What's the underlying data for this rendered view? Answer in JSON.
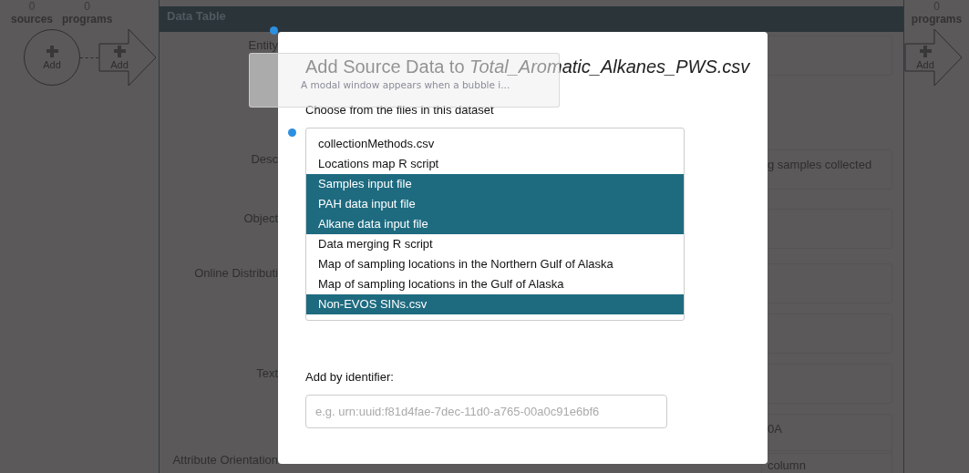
{
  "left_panel": {
    "counts": [
      {
        "number": "0",
        "label": "sources"
      },
      {
        "number": "0",
        "label": "programs"
      }
    ],
    "source_add": "Add",
    "program_add": "Add"
  },
  "data_table": {
    "title": "Data Table",
    "rows": [
      {
        "label": "Entity"
      },
      {
        "label": "Desc",
        "value": "g samples collected"
      },
      {
        "label": "Object"
      },
      {
        "label": "Online Distributi"
      },
      {},
      {
        "label": "Text"
      },
      {
        "value": "0A"
      },
      {
        "label": "Attribute Orientation",
        "value": "column"
      }
    ]
  },
  "right_panel": {
    "count": {
      "number": "0",
      "label": "programs"
    },
    "program_add": "Add"
  },
  "modal": {
    "title": "Add Source Data to *Total_Aromatic_Alkanes_PWS.csv*",
    "list_label": "Choose from the files in this dataset",
    "files": [
      {
        "name": "collectionMethods.csv",
        "selected": false
      },
      {
        "name": "Locations map R script",
        "selected": false
      },
      {
        "name": "Samples input file",
        "selected": true
      },
      {
        "name": "PAH data input file",
        "selected": true
      },
      {
        "name": "Alkane data input file",
        "selected": true
      },
      {
        "name": "Data merging R script",
        "selected": false
      },
      {
        "name": "Map of sampling locations in the Northern Gulf of Alaska",
        "selected": false
      },
      {
        "name": "Map of sampling locations in the Gulf of Alaska",
        "selected": false
      },
      {
        "name": "Non-EVOS SINs.csv",
        "selected": true
      }
    ],
    "identifier_label": "Add by identifier:",
    "identifier_placeholder": "e.g. urn:uuid:f81d4fae-7dec-11d0-a765-00a0c91e6bf6"
  },
  "tooltip": {
    "text": "A modal window appears when a bubble i..."
  }
}
